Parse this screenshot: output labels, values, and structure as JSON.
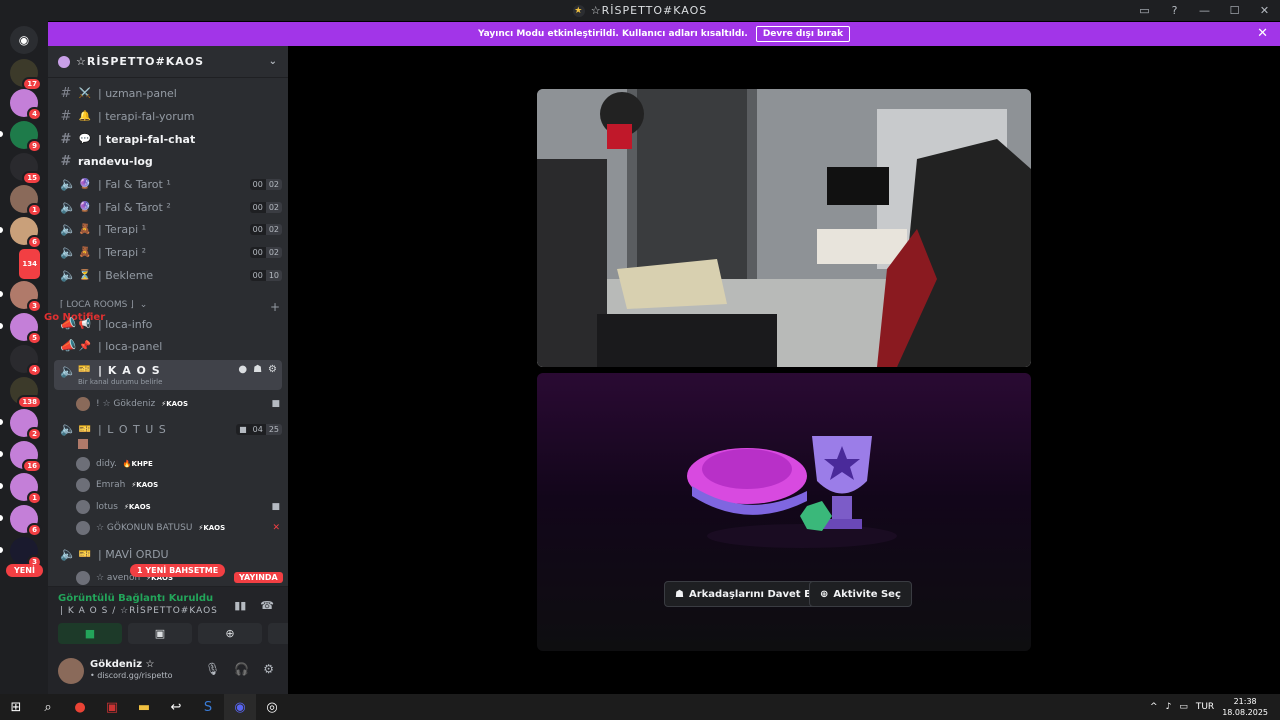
{
  "window": {
    "title": "☆RİSPETTO#KAOS"
  },
  "banner": {
    "text": "Yayıncı Modu etkinleştirildi. Kullanıcı adları kısaltıldı.",
    "button": "Devre dışı bırak"
  },
  "servers": {
    "badges": [
      "17",
      "4",
      "9",
      "15",
      "1",
      "6",
      "134",
      "3",
      "5",
      "4",
      "138",
      "2",
      "16",
      "1",
      "6",
      "3"
    ],
    "new_label": "YENİ"
  },
  "guild": {
    "name": "☆RİSPETTO#KAOS"
  },
  "channels": [
    {
      "emoji": "⚔️",
      "name": "| uzman-panel"
    },
    {
      "emoji": "🔔",
      "name": "| terapi-fal-yorum"
    },
    {
      "emoji": "💬",
      "name": "| terapi-fal-chat"
    },
    {
      "name": "randevu-log"
    },
    {
      "emoji": "🔮",
      "name": "| Fal & Tarot ¹",
      "c1": "00",
      "c2": "02"
    },
    {
      "emoji": "🔮",
      "name": "| Fal & Tarot ²",
      "c1": "00",
      "c2": "02"
    },
    {
      "emoji": "🧸",
      "name": "| Terapi ¹",
      "c1": "00",
      "c2": "02"
    },
    {
      "emoji": "🧸",
      "name": "| Terapi ²",
      "c1": "00",
      "c2": "02"
    },
    {
      "emoji": "⏳",
      "name": "| Bekleme",
      "c1": "00",
      "c2": "10"
    }
  ],
  "category": {
    "name": "⌈ LOCA ROOMS ⌋",
    "overlay": "Go Notifier"
  },
  "loca_channels": [
    {
      "emoji": "📢",
      "name": "| loca-info"
    },
    {
      "emoji": "📌",
      "name": "| loca-panel"
    }
  ],
  "active_channel": {
    "emoji": "🎫",
    "name": "| K A O S",
    "status": "Bir kanal durumu belirle"
  },
  "kaos_users": [
    {
      "name": "! ☆ Gökdeniz",
      "tag": "⚡KAOS"
    }
  ],
  "lotus": {
    "name": "| L O T U S",
    "c1": "04",
    "c2": "25"
  },
  "lotus_users": [
    {
      "name": "didy.",
      "tag": "🔥KHPE"
    },
    {
      "name": "Emrah",
      "tag": "⚡KAOS"
    },
    {
      "name": "lotus",
      "tag": "⚡KAOS"
    },
    {
      "name": "☆ GÖKONUN BATUSU",
      "tag": "⚡KAOS"
    }
  ],
  "mavi": {
    "name": "| MAVİ ORDU"
  },
  "mavi_users": [
    {
      "name": "☆ avenon",
      "tag": "⚡KAOS"
    }
  ],
  "mention_pill": "1 YENİ BAHSETME",
  "live_pill": "YAYINDA",
  "voice": {
    "status": "Görüntülü Bağlantı Kuruldu",
    "channel": "| K A O S / ☆RİSPETTO#KAOS"
  },
  "user": {
    "name": "Gökdeniz ☆",
    "status": "• discord.gg/rispetto"
  },
  "activity": {
    "invite": "Arkadaşlarını Davet Et",
    "choose": "Aktivite Seç"
  },
  "taskbar": {
    "lang": "TUR",
    "time": "21:38",
    "date": "18.08.2025"
  }
}
